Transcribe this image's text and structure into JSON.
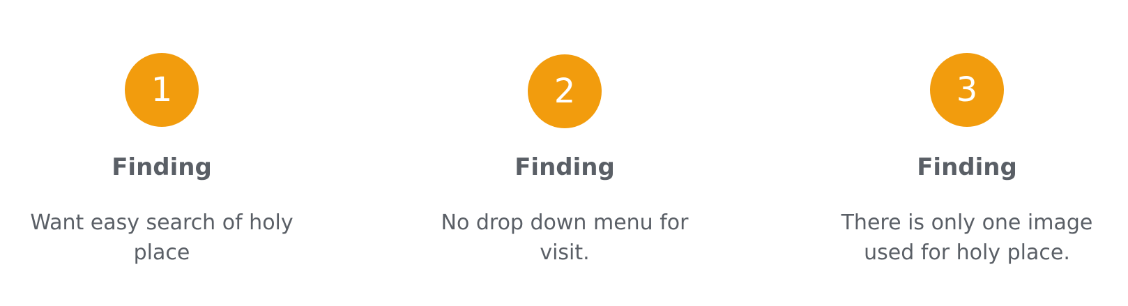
{
  "accent_color": "#f29c0d",
  "text_color": "#5a5f66",
  "steps": [
    {
      "number": "1",
      "title": "Finding",
      "description": "Want easy search of holy place"
    },
    {
      "number": "2",
      "title": "Finding",
      "description": "No drop down menu for visit."
    },
    {
      "number": "3",
      "title": "Finding",
      "description": "There is only one image used for holy place."
    }
  ]
}
